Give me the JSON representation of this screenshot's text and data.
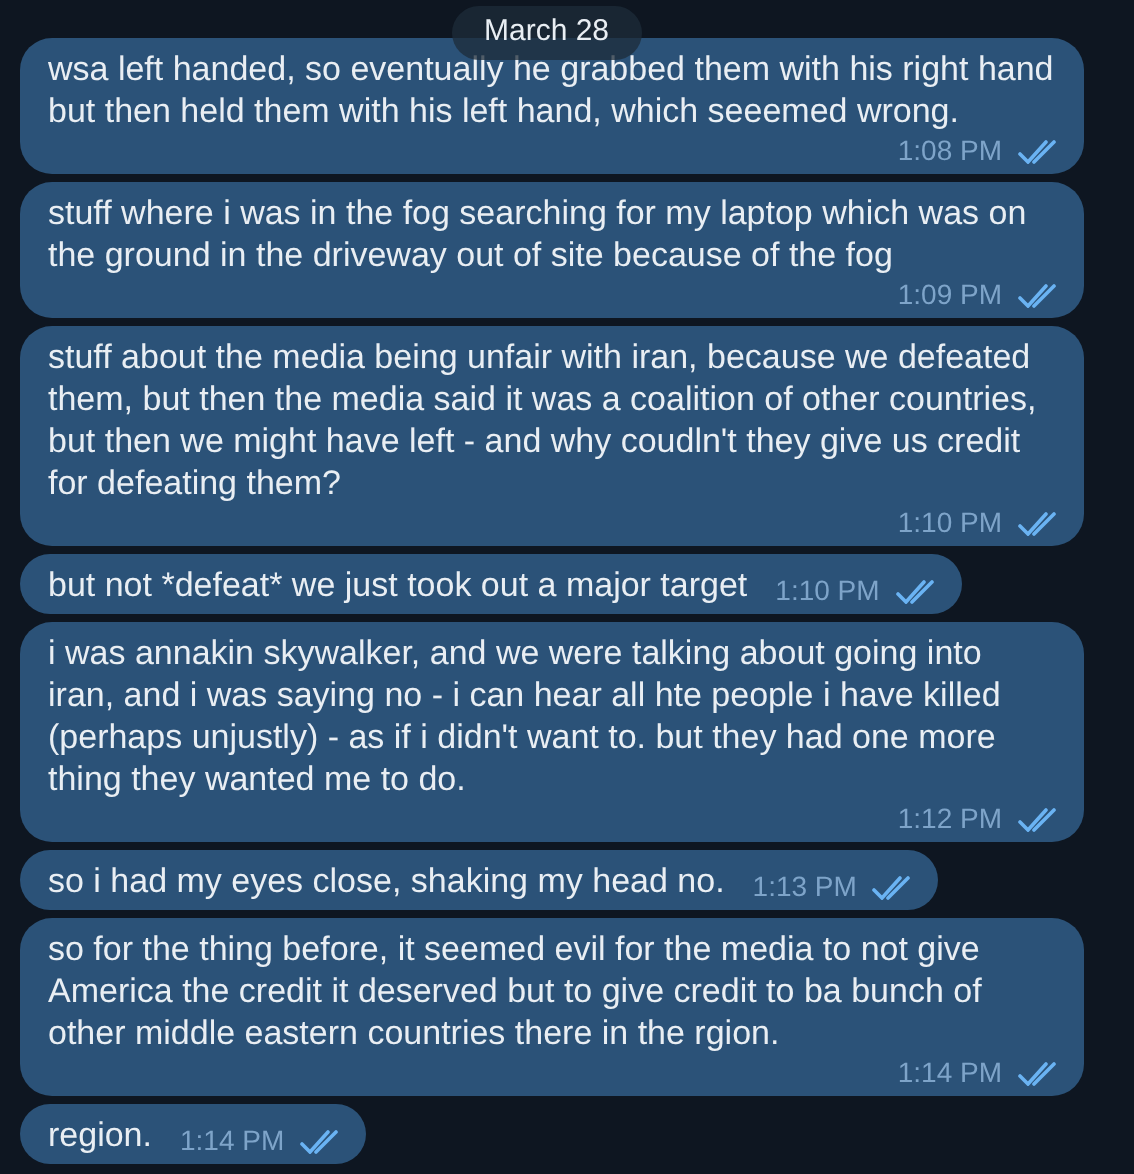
{
  "date_badge": "March 28",
  "messages": [
    {
      "text": "wsa left handed, so eventually he grabbed them with his right hand but then held them with his left hand, which seeemed wrong.",
      "time": "1:08 PM",
      "read": true
    },
    {
      "text": "stuff where i was in the fog searching for my laptop which was on the ground in the driveway out of site because of the fog",
      "time": "1:09 PM",
      "read": true
    },
    {
      "text": "stuff about the media being unfair with iran, because we defeated them, but then the media said it was a coalition of other countries, but then we might have left - and why coudln't they give us credit for defeating them?",
      "time": "1:10 PM",
      "read": true
    },
    {
      "text": "but not *defeat* we just took out a major target",
      "time": "1:10 PM",
      "read": true
    },
    {
      "text": "i was annakin skywalker, and we were talking about going into iran, and i was saying no - i can hear all hte people i have killed (perhaps unjustly) - as if i didn't want to. but they had one more thing they wanted me to do.",
      "time": "1:12 PM",
      "read": true
    },
    {
      "text": "so i had my eyes close, shaking my head no.",
      "time": "1:13 PM",
      "read": true
    },
    {
      "text": "so for the thing before, it seemed evil for the media to not give America the credit it deserved but to give credit to ba bunch of other middle eastern countries there in the rgion.",
      "time": "1:14 PM",
      "read": true
    },
    {
      "text": "region.",
      "time": "1:14 PM",
      "read": true
    }
  ]
}
